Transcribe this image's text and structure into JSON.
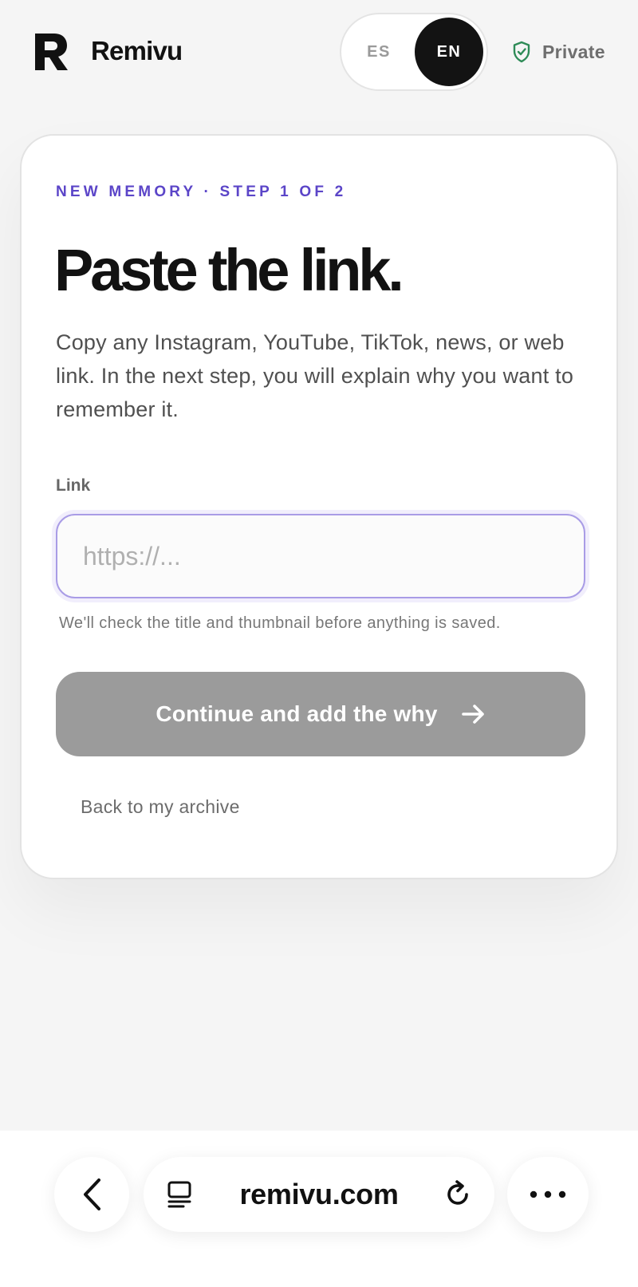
{
  "header": {
    "brand_name": "Remivu",
    "logo_letter": "R",
    "language": {
      "options": [
        "ES",
        "EN"
      ],
      "selected": "EN"
    },
    "privacy_label": "Private",
    "privacy_color": "#2e8b57"
  },
  "card": {
    "eyebrow": "NEW MEMORY · STEP 1 OF 2",
    "title": "Paste the link.",
    "description": "Copy any Instagram, YouTube, TikTok, news, or web link. In the next step, you will explain why you want to remember it.",
    "field_label": "Link",
    "input_value": "",
    "input_placeholder": "https://...",
    "helper_text": "We'll check the title and thumbnail before anything is saved.",
    "continue_label": "Continue and add the why",
    "back_label": "Back to my archive",
    "accent_color": "#5b45c8"
  },
  "browser": {
    "url": "remivu.com",
    "icons": [
      "back-icon",
      "reader-icon",
      "reload-icon",
      "more-icon"
    ]
  }
}
